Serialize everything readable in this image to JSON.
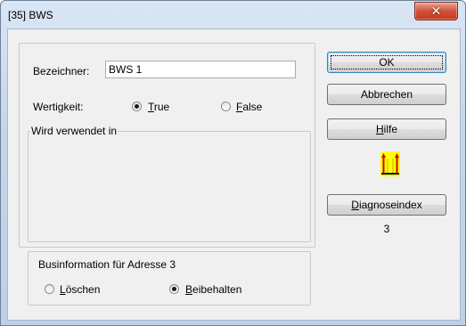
{
  "window": {
    "title": "[35] BWS"
  },
  "bezeichner": {
    "label_prefix": "Bezeichner",
    "label_suffix": ":",
    "value": "BWS 1"
  },
  "wertigkeit": {
    "label": "Wertigkeit:",
    "options": [
      {
        "underline": "T",
        "rest": "rue",
        "selected": true
      },
      {
        "underline": "F",
        "rest": "alse",
        "selected": false
      }
    ]
  },
  "verwendet_group": {
    "caption": "Wird verwendet in"
  },
  "busgroup": {
    "caption": "Businformation für Adresse 3",
    "options": [
      {
        "underline": "L",
        "rest": "öschen",
        "selected": false
      },
      {
        "underline": "B",
        "rest": "eibehalten",
        "selected": true
      }
    ]
  },
  "buttons": {
    "ok": "OK",
    "abbrechen": "Abbrechen",
    "hilfe_underline": "H",
    "hilfe_rest": "ilfe",
    "diagnose_underline": "D",
    "diagnose_rest": "iagnoseindex"
  },
  "diagnose_value": "3",
  "icons": {
    "close": "close-icon",
    "diagnose": "diagnose-icon"
  },
  "colors": {
    "close_button": "#c94a33",
    "icon_yellow": "#ffff00",
    "icon_red": "#d40000"
  }
}
